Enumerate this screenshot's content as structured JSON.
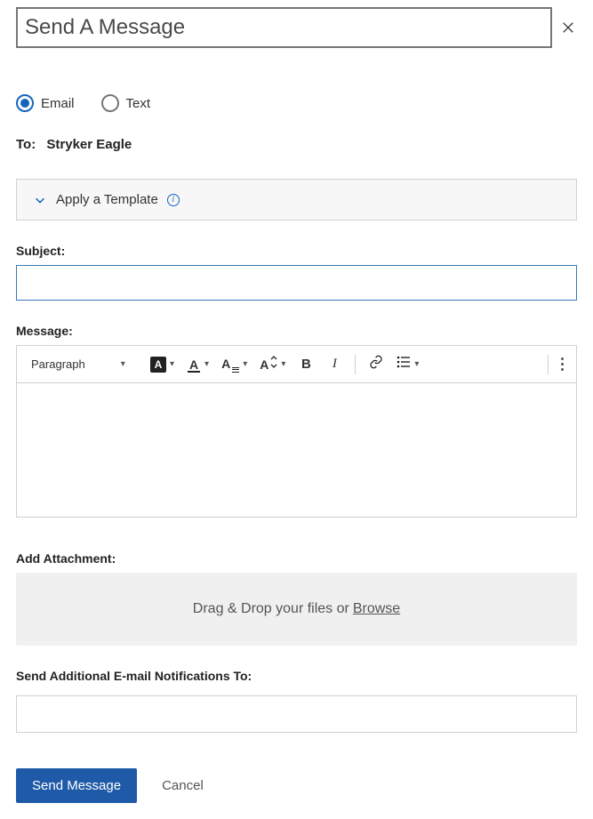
{
  "title": "Send A Message",
  "messageType": {
    "email_label": "Email",
    "text_label": "Text",
    "selected": "email"
  },
  "to": {
    "label": "To:",
    "recipient": "Stryker Eagle"
  },
  "template": {
    "label": "Apply a Template"
  },
  "subject": {
    "label": "Subject:",
    "value": ""
  },
  "message": {
    "label": "Message:",
    "format_select": "Paragraph",
    "value": ""
  },
  "attachment": {
    "label": "Add Attachment:",
    "dropzone_text": "Drag & Drop your files or",
    "browse": "Browse"
  },
  "notify": {
    "label": "Send Additional E-mail Notifications To:",
    "value": ""
  },
  "buttons": {
    "send": "Send Message",
    "cancel": "Cancel"
  }
}
